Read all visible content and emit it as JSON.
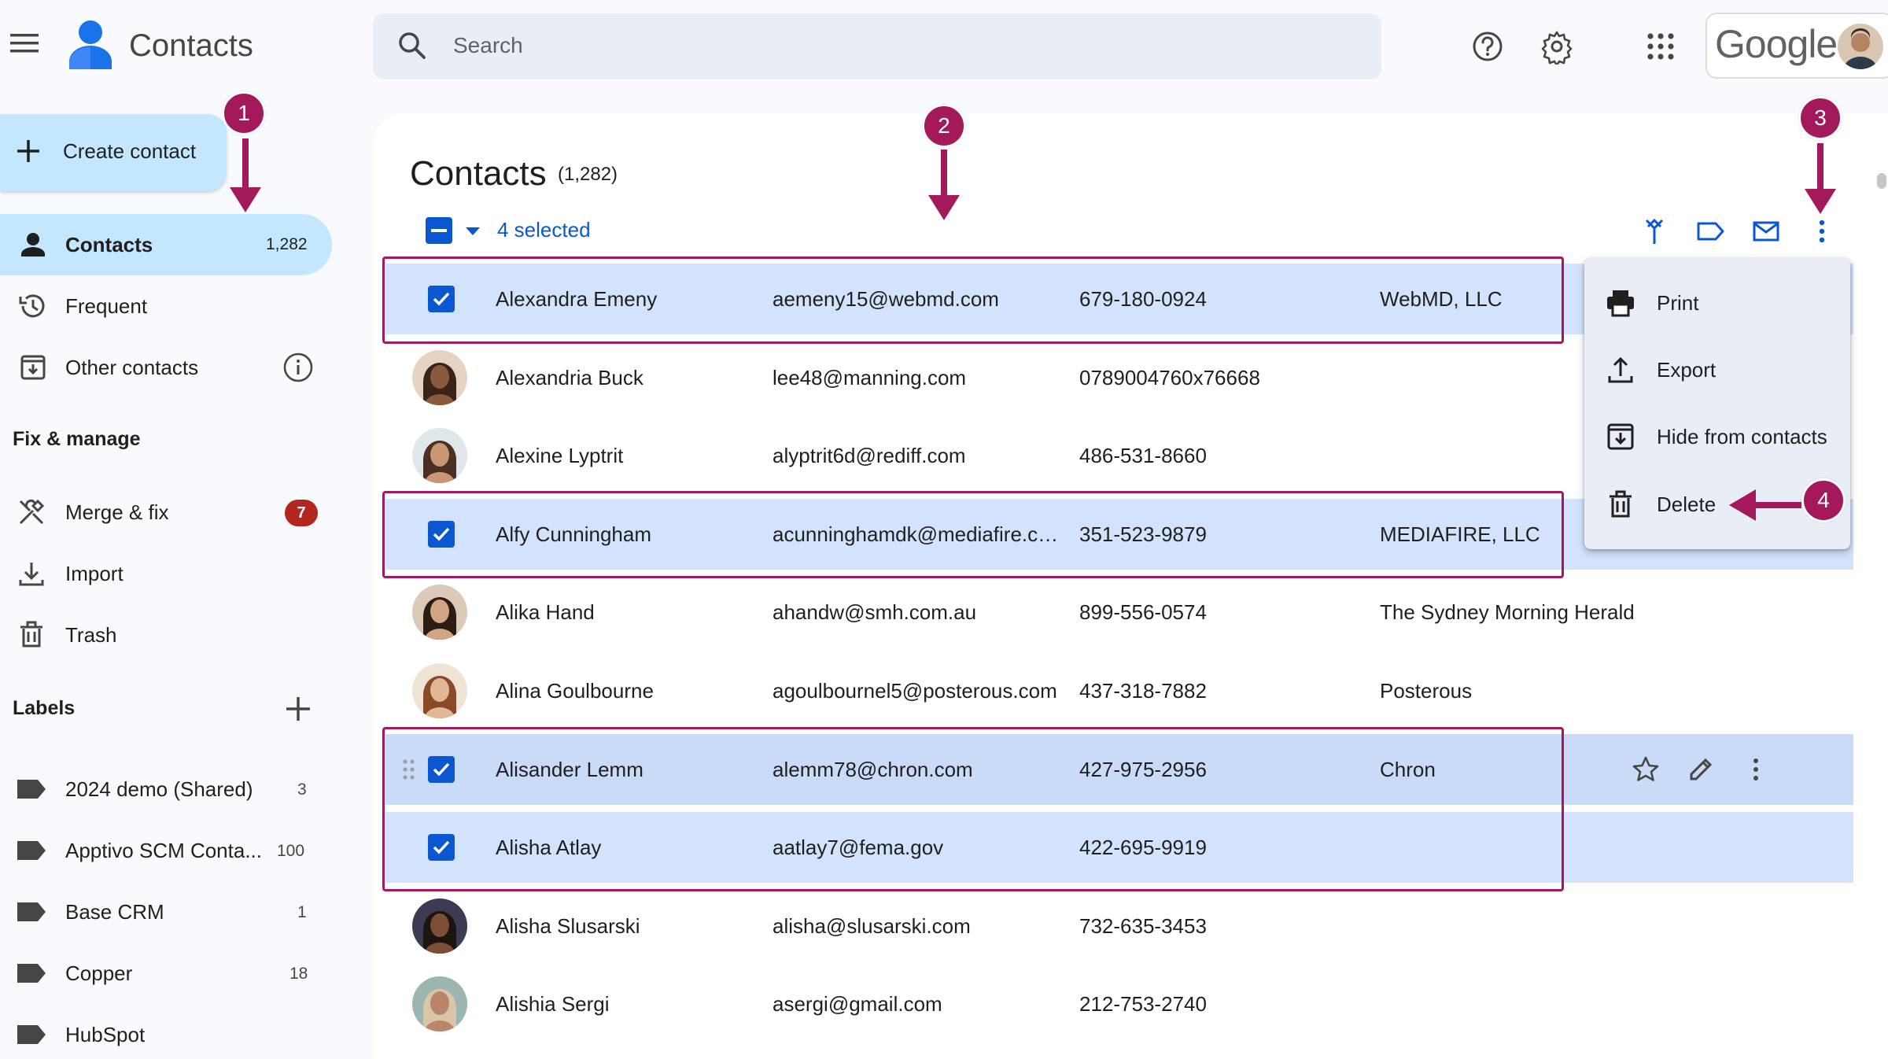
{
  "app": {
    "title": "Contacts"
  },
  "search": {
    "placeholder": "Search"
  },
  "account": {
    "brand": "Google"
  },
  "sidebar": {
    "create_label": "Create contact",
    "nav": [
      {
        "label": "Contacts",
        "count": "1,282",
        "icon": "person-icon",
        "active": true
      },
      {
        "label": "Frequent",
        "icon": "history-icon"
      },
      {
        "label": "Other contacts",
        "icon": "archive-download-icon"
      }
    ],
    "fix_manage_heading": "Fix & manage",
    "fix_items": [
      {
        "label": "Merge & fix",
        "badge": "7",
        "icon": "merge-tools-icon"
      },
      {
        "label": "Import",
        "icon": "download-icon"
      },
      {
        "label": "Trash",
        "icon": "trash-icon"
      }
    ],
    "labels_heading": "Labels",
    "labels": [
      {
        "label": "2024 demo (Shared)",
        "count": "3"
      },
      {
        "label": "Apptivo SCM Conta...",
        "count": "100"
      },
      {
        "label": "Base CRM",
        "count": "1"
      },
      {
        "label": "Copper",
        "count": "18"
      },
      {
        "label": "HubSpot",
        "count": ""
      }
    ]
  },
  "main": {
    "title": "Contacts",
    "count": "(1,282)",
    "selection_label": "4 selected"
  },
  "contacts": [
    {
      "name": "Alexandra Emeny",
      "email": "aemeny15@webmd.com",
      "phone": "679-180-0924",
      "company": "WebMD, LLC",
      "selected": true
    },
    {
      "name": "Alexandria Buck",
      "email": "lee48@manning.com",
      "phone": "0789004760x76668",
      "company": "",
      "selected": false
    },
    {
      "name": "Alexine Lyptrit",
      "email": "alyptrit6d@rediff.com",
      "phone": "486-531-8660",
      "company": "",
      "selected": false
    },
    {
      "name": "Alfy Cunningham",
      "email": "acunninghamdk@mediafire.co...",
      "phone": "351-523-9879",
      "company": "MEDIAFIRE, LLC",
      "selected": true
    },
    {
      "name": "Alika Hand",
      "email": "ahandw@smh.com.au",
      "phone": "899-556-0574",
      "company": "The Sydney Morning Herald",
      "selected": false
    },
    {
      "name": "Alina Goulbourne",
      "email": "agoulbournel5@posterous.com",
      "phone": "437-318-7882",
      "company": "Posterous",
      "selected": false
    },
    {
      "name": "Alisander Lemm",
      "email": "alemm78@chron.com",
      "phone": "427-975-2956",
      "company": "Chron",
      "selected": true
    },
    {
      "name": "Alisha Atlay",
      "email": "aatlay7@fema.gov",
      "phone": "422-695-9919",
      "company": "",
      "selected": true
    },
    {
      "name": "Alisha Slusarski",
      "email": "alisha@slusarski.com",
      "phone": "732-635-3453",
      "company": "",
      "selected": false
    },
    {
      "name": "Alishia Sergi",
      "email": "asergi@gmail.com",
      "phone": "212-753-2740",
      "company": "",
      "selected": false
    }
  ],
  "more_menu": {
    "items": [
      {
        "label": "Print",
        "icon": "print-icon"
      },
      {
        "label": "Export",
        "icon": "upload-icon"
      },
      {
        "label": "Hide from contacts",
        "icon": "archive-download-icon"
      },
      {
        "label": "Delete",
        "icon": "trash-icon"
      }
    ]
  },
  "annotations": {
    "markers": [
      "1",
      "2",
      "3",
      "4"
    ],
    "color": "#a3195b"
  },
  "colors": {
    "accent": "#0b57d0",
    "selected_row": "#d3e3fd",
    "nav_active": "#c2e7ff",
    "badge": "#b3261e"
  }
}
